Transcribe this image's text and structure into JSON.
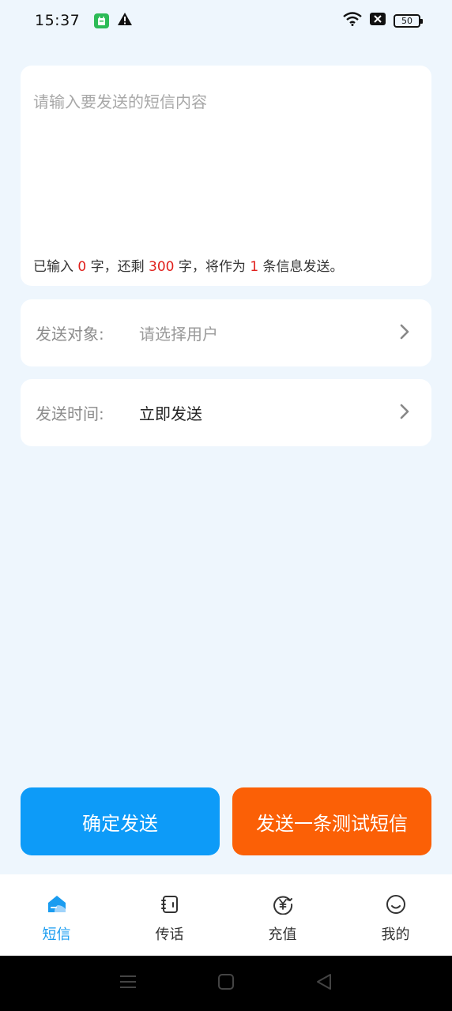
{
  "status_bar": {
    "time": "15:37",
    "battery": "50",
    "icons": [
      "app-badge-icon",
      "warning-icon",
      "wifi-icon",
      "sim-off-icon",
      "battery-icon"
    ]
  },
  "message": {
    "placeholder": "请输入要发送的短信内容",
    "value": "",
    "counter": {
      "prefix": "已输入 ",
      "typed": "0",
      "mid1": " 字，还剩 ",
      "remaining": "300",
      "mid2": " 字，将作为 ",
      "parts": "1",
      "suffix": " 条信息发送。"
    }
  },
  "target_row": {
    "label": "发送对象:",
    "value": "请选择用户"
  },
  "time_row": {
    "label": "发送时间:",
    "value": "立即发送"
  },
  "buttons": {
    "confirm": "确定发送",
    "test": "发送一条测试短信"
  },
  "tabs": [
    {
      "label": "短信",
      "icon": "sms-home-icon",
      "active": true
    },
    {
      "label": "传话",
      "icon": "notebook-icon",
      "active": false
    },
    {
      "label": "充值",
      "icon": "yuan-recharge-icon",
      "active": false
    },
    {
      "label": "我的",
      "icon": "smiley-profile-icon",
      "active": false
    }
  ],
  "colors": {
    "accent_blue": "#0d9bf8",
    "accent_orange": "#fb6006",
    "highlight_red": "#e0201c",
    "background": "#eef6fd"
  }
}
